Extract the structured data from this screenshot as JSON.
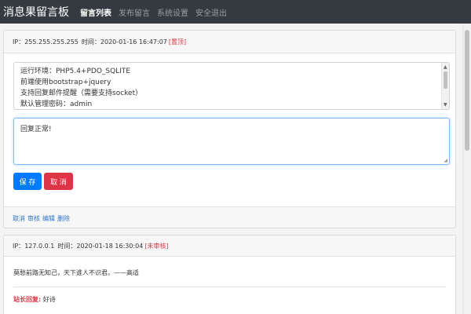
{
  "navbar": {
    "brand": "消息果留言板",
    "links": [
      "留言列表",
      "发布留言",
      "系统设置",
      "安全退出"
    ]
  },
  "card1": {
    "header": {
      "ip_label": "IP：",
      "ip": "255.255.255.255",
      "time_label": "时间：",
      "time": "2020-01-16 16:47:07",
      "tag": "[置顶]"
    },
    "content_lines": [
      "运行环境：PHP5.4+PDO_SQLITE",
      "前端使用bootstrap+jquery",
      "支持回复邮件提醒（需要支持socket）",
      "默认管理密码：admin"
    ],
    "reply_value": "回复正常!",
    "buttons": {
      "save": "保 存",
      "cancel": "取 消"
    },
    "footer_links": [
      "取消",
      "审核",
      "编辑",
      "删除"
    ]
  },
  "card2": {
    "header": {
      "ip_label": "IP：",
      "ip": "127.0.0.1",
      "time_label": "时间：",
      "time": "2020-01-18 16:30:04",
      "tag": "[未审核]"
    },
    "message": "莫愁前路无知己，天下谁人不识君。——高适",
    "reply_label": "站长回复:",
    "reply_text": "好诗"
  },
  "colors": {
    "navbar_bg": "#343a40",
    "primary": "#007bff",
    "danger": "#dc3545",
    "link": "#2f76c8"
  }
}
